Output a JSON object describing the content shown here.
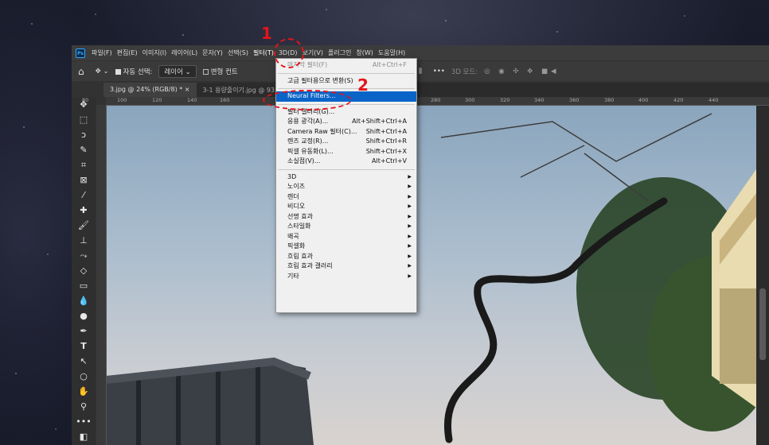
{
  "menubar": {
    "logo": "Ps",
    "items": [
      "파일(F)",
      "편집(E)",
      "이미지(I)",
      "레이어(L)",
      "문자(Y)",
      "선택(S)",
      "필터(T)",
      "3D(D)",
      "보기(V)",
      "플러그인",
      "창(W)",
      "도움말(H)"
    ]
  },
  "options": {
    "auto_select_label": "자동 선택:",
    "layer_dropdown": "레이어",
    "transform_label": "변형 컨트",
    "mode_3d": "3D 모드:"
  },
  "tabs": [
    "3.jpg @ 24% (RGB/8) *",
    "3-1 용량줄이기.jpg @ 93"
  ],
  "ruler_ticks": [
    "80",
    "100",
    "120",
    "140",
    "160",
    "260",
    "280",
    "300",
    "320",
    "340",
    "360",
    "380",
    "400",
    "420",
    "440"
  ],
  "filter_menu": {
    "items": [
      {
        "label": "마지막 필터(F)",
        "shortcut": "Alt+Ctrl+F",
        "disabled": true
      },
      {
        "separator": true
      },
      {
        "label": "고급 필터용으로 변환(S)"
      },
      {
        "separator": true
      },
      {
        "label": "Neural Filters...",
        "highlighted": true
      },
      {
        "separator": true
      },
      {
        "label": "필터 갤러리(G)..."
      },
      {
        "label": "응용 광각(A)...",
        "shortcut": "Alt+Shift+Ctrl+A"
      },
      {
        "label": "Camera Raw 필터(C)...",
        "shortcut": "Shift+Ctrl+A"
      },
      {
        "label": "렌즈 교정(R)...",
        "shortcut": "Shift+Ctrl+R"
      },
      {
        "label": "픽셀 유동화(L)...",
        "shortcut": "Shift+Ctrl+X"
      },
      {
        "label": "소실점(V)...",
        "shortcut": "Alt+Ctrl+V"
      },
      {
        "separator": true
      },
      {
        "label": "3D",
        "submenu": true
      },
      {
        "label": "노이즈",
        "submenu": true
      },
      {
        "label": "렌더",
        "submenu": true
      },
      {
        "label": "비디오",
        "submenu": true
      },
      {
        "label": "선명 효과",
        "submenu": true
      },
      {
        "label": "스타일화",
        "submenu": true
      },
      {
        "label": "왜곡",
        "submenu": true
      },
      {
        "label": "픽셀화",
        "submenu": true
      },
      {
        "label": "흐림 효과",
        "submenu": true
      },
      {
        "label": "흐림 효과 갤러리",
        "submenu": true
      },
      {
        "label": "기타",
        "submenu": true
      }
    ]
  },
  "annotations": {
    "step1": "1",
    "step2": "2",
    "color": "#e4141b"
  },
  "colors": {
    "highlight": "#0a64c8",
    "ps_blue": "#31a8ff"
  }
}
